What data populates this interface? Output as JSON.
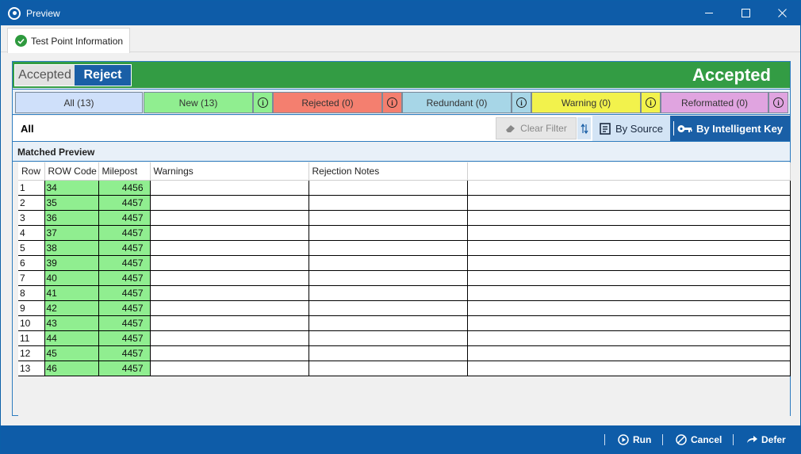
{
  "window": {
    "title": "Preview",
    "minimize_label": "─",
    "maximize_label": "☐",
    "close_label": "✕"
  },
  "tab": {
    "label": "Test Point Information"
  },
  "status": {
    "toggle_accepted": "Accepted",
    "toggle_reject": "Reject",
    "title": "Accepted",
    "color": "#339c44"
  },
  "filters": [
    {
      "label": "All (13)",
      "color": "#cfe0fa"
    },
    {
      "label": "New (13)",
      "color": "#90ee90"
    },
    {
      "label": "Rejected (0)",
      "color": "#f47f6f"
    },
    {
      "label": "Redundant (0)",
      "color": "#a7d6e7"
    },
    {
      "label": "Warning (0)",
      "color": "#f2f24c"
    },
    {
      "label": "Reformatted (0)",
      "color": "#e0a4e0"
    }
  ],
  "toolbar": {
    "filter_label": "All",
    "clear_filter": "Clear Filter",
    "by_source": "By Source",
    "by_key": "By Intelligent Key"
  },
  "preview": {
    "header": "Matched Preview"
  },
  "table": {
    "columns": [
      "Row",
      "ROW Code",
      "Milepost",
      "Warnings",
      "Rejection Notes",
      ""
    ],
    "rows": [
      [
        "1",
        "34",
        "4456",
        "",
        ""
      ],
      [
        "2",
        "35",
        "4457",
        "",
        ""
      ],
      [
        "3",
        "36",
        "4457",
        "",
        ""
      ],
      [
        "4",
        "37",
        "4457",
        "",
        ""
      ],
      [
        "5",
        "38",
        "4457",
        "",
        ""
      ],
      [
        "6",
        "39",
        "4457",
        "",
        ""
      ],
      [
        "7",
        "40",
        "4457",
        "",
        ""
      ],
      [
        "8",
        "41",
        "4457",
        "",
        ""
      ],
      [
        "9",
        "42",
        "4457",
        "",
        ""
      ],
      [
        "10",
        "43",
        "4457",
        "",
        ""
      ],
      [
        "11",
        "44",
        "4457",
        "",
        ""
      ],
      [
        "12",
        "45",
        "4457",
        "",
        ""
      ],
      [
        "13",
        "46",
        "4457",
        "",
        ""
      ]
    ]
  },
  "actions": {
    "run": "Run",
    "cancel": "Cancel",
    "defer": "Defer"
  }
}
